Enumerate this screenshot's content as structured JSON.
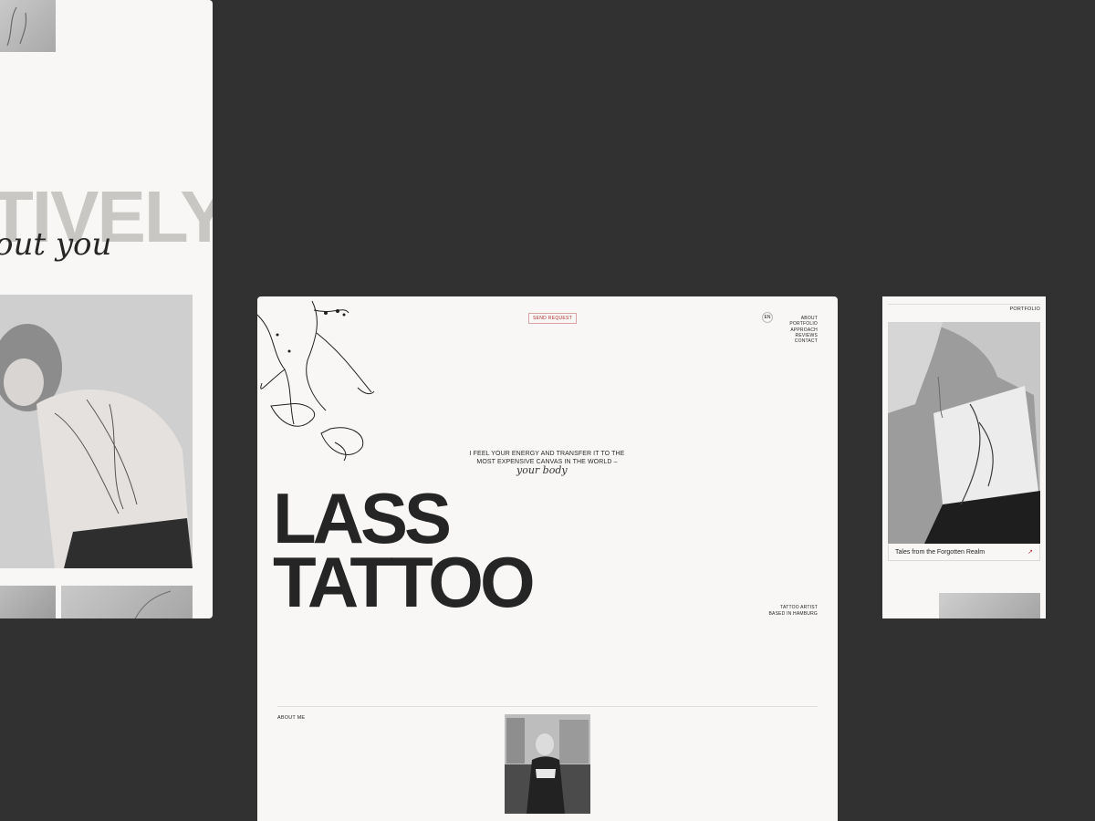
{
  "left": {
    "big_word": "TIVELY.",
    "script": "out you"
  },
  "main": {
    "send_request": "SEND REQUEST",
    "lang": "EN",
    "nav": [
      "ABOUT",
      "PORTFOLIO",
      "APPROACH",
      "REVIEWS",
      "CONTACT"
    ],
    "quote_line1": "I FEEL YOUR ENERGY AND TRANSFER IT TO THE",
    "quote_line2": "MOST EXPENSIVE CANVAS IN THE WORLD –",
    "quote_script": "your body",
    "hero_line1": "LASS",
    "hero_line2": "TATTOO",
    "meta_line1": "TATTOO ARTIST",
    "meta_line2": "BASED IN HAMBURG",
    "about_label": "ABOUT ME"
  },
  "right": {
    "label": "PORTFOLIO",
    "caption": "Tales from the Forgotten Realm",
    "arrow": "↗"
  },
  "colors": {
    "background": "#313131",
    "card": "#f8f7f5",
    "accent": "#b53030",
    "text": "#252525"
  }
}
